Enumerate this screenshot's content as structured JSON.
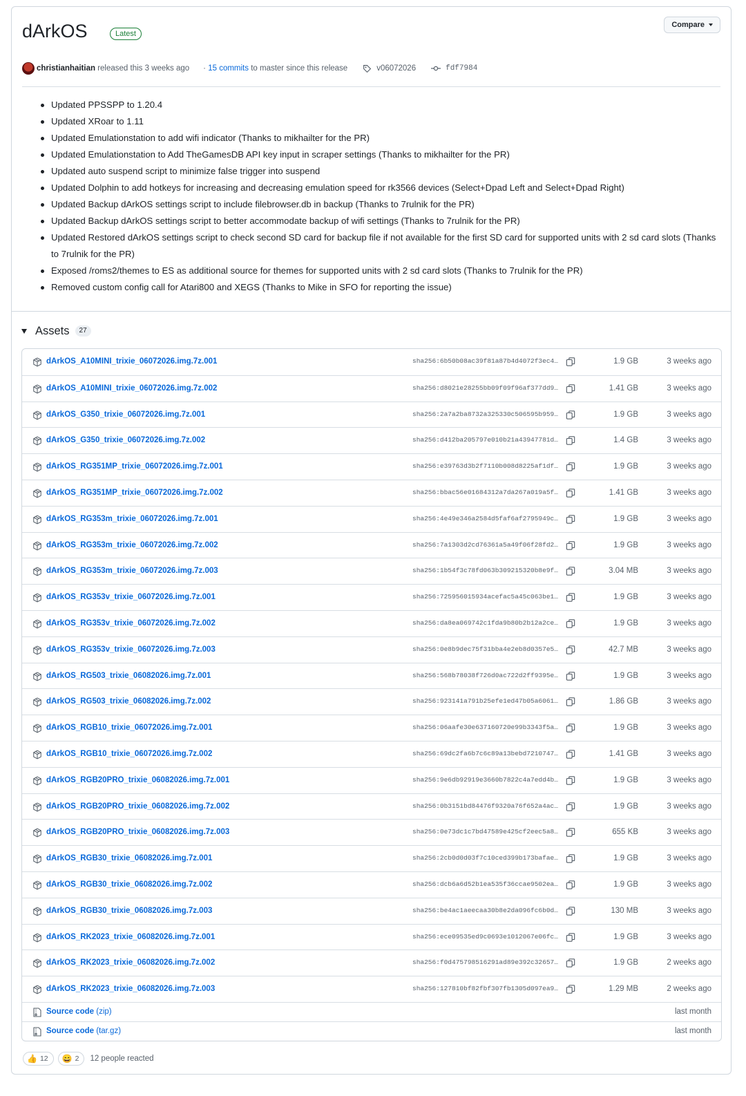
{
  "release": {
    "title": "dArkOS",
    "badge": "Latest",
    "compare_label": "Compare",
    "author": "christianhaitian",
    "released_text": "released this 3 weeks ago",
    "commits_link": "15 commits",
    "commits_text": "to master since this release",
    "tag": "v06072026",
    "commit": "fdf7984"
  },
  "notes": [
    "Updated PPSSPP to 1.20.4",
    "Updated XRoar to 1.11",
    "Updated Emulationstation to add wifi indicator (Thanks to mikhailter for the PR)",
    "Updated Emulationstation to Add TheGamesDB API key input in scraper settings (Thanks to mikhailter for the PR)",
    "Updated auto suspend script to minimize false trigger into suspend",
    "Updated Dolphin to add hotkeys for increasing and decreasing emulation speed for rk3566 devices (Select+Dpad Left and Select+Dpad Right)",
    "Updated Backup dArkOS settings script to include filebrowser.db in backup (Thanks to 7rulnik for the PR)",
    "Updated Backup dArkOS settings script to better accommodate backup of wifi settings (Thanks to 7rulnik for the PR)",
    "Updated Restored dArkOS settings script to check second SD card for backup file if not available for the first SD card for supported units with 2 sd card slots (Thanks to 7rulnik for the PR)",
    "Exposed /roms2/themes to ES as additional source for themes for supported units with 2 sd card slots (Thanks to 7rulnik for the PR)",
    "Removed custom config call for Atari800 and XEGS (Thanks to Mike in SFO for reporting the issue)"
  ],
  "assets": {
    "label": "Assets",
    "count": "27",
    "files": [
      {
        "name": "dArkOS_A10MINI_trixie_06072026.img.7z.001",
        "sha": "sha256:6b50b08ac39f81a87b4d4072f3ec4...",
        "size": "1.9 GB",
        "date": "3 weeks ago"
      },
      {
        "name": "dArkOS_A10MINI_trixie_06072026.img.7z.002",
        "sha": "sha256:d8021e28255bb09f09f96af377dd9...",
        "size": "1.41 GB",
        "date": "3 weeks ago"
      },
      {
        "name": "dArkOS_G350_trixie_06072026.img.7z.001",
        "sha": "sha256:2a7a2ba8732a325330c506595b959...",
        "size": "1.9 GB",
        "date": "3 weeks ago"
      },
      {
        "name": "dArkOS_G350_trixie_06072026.img.7z.002",
        "sha": "sha256:d412ba205797e010b21a43947781d...",
        "size": "1.4 GB",
        "date": "3 weeks ago"
      },
      {
        "name": "dArkOS_RG351MP_trixie_06072026.img.7z.001",
        "sha": "sha256:e39763d3b2f7110b008d8225af1df...",
        "size": "1.9 GB",
        "date": "3 weeks ago"
      },
      {
        "name": "dArkOS_RG351MP_trixie_06072026.img.7z.002",
        "sha": "sha256:bbac56e01684312a7da267a019a5f...",
        "size": "1.41 GB",
        "date": "3 weeks ago"
      },
      {
        "name": "dArkOS_RG353m_trixie_06072026.img.7z.001",
        "sha": "sha256:4e49e346a2584d5faf6af2795949c...",
        "size": "1.9 GB",
        "date": "3 weeks ago"
      },
      {
        "name": "dArkOS_RG353m_trixie_06072026.img.7z.002",
        "sha": "sha256:7a1303d2cd76361a5a49f06f28fd2...",
        "size": "1.9 GB",
        "date": "3 weeks ago"
      },
      {
        "name": "dArkOS_RG353m_trixie_06072026.img.7z.003",
        "sha": "sha256:1b54f3c78fd063b309215320b8e9f...",
        "size": "3.04 MB",
        "date": "3 weeks ago"
      },
      {
        "name": "dArkOS_RG353v_trixie_06072026.img.7z.001",
        "sha": "sha256:725956015934acefac5a45c063be1...",
        "size": "1.9 GB",
        "date": "3 weeks ago"
      },
      {
        "name": "dArkOS_RG353v_trixie_06072026.img.7z.002",
        "sha": "sha256:da8ea069742c1fda9b80b2b12a2ce...",
        "size": "1.9 GB",
        "date": "3 weeks ago"
      },
      {
        "name": "dArkOS_RG353v_trixie_06072026.img.7z.003",
        "sha": "sha256:0e8b9dec75f31bba4e2eb8d0357e5...",
        "size": "42.7 MB",
        "date": "3 weeks ago"
      },
      {
        "name": "dArkOS_RG503_trixie_06082026.img.7z.001",
        "sha": "sha256:568b78038f726d0ac722d2ff9395e...",
        "size": "1.9 GB",
        "date": "3 weeks ago"
      },
      {
        "name": "dArkOS_RG503_trixie_06082026.img.7z.002",
        "sha": "sha256:923141a791b25efe1ed47b05a6061...",
        "size": "1.86 GB",
        "date": "3 weeks ago"
      },
      {
        "name": "dArkOS_RGB10_trixie_06072026.img.7z.001",
        "sha": "sha256:06aafe30e637160720e99b3343f5a...",
        "size": "1.9 GB",
        "date": "3 weeks ago"
      },
      {
        "name": "dArkOS_RGB10_trixie_06072026.img.7z.002",
        "sha": "sha256:69dc2fa6b7c6c89a13bebd7210747...",
        "size": "1.41 GB",
        "date": "3 weeks ago"
      },
      {
        "name": "dArkOS_RGB20PRO_trixie_06082026.img.7z.001",
        "sha": "sha256:9e6db92919e3660b7822c4a7edd4b...",
        "size": "1.9 GB",
        "date": "3 weeks ago"
      },
      {
        "name": "dArkOS_RGB20PRO_trixie_06082026.img.7z.002",
        "sha": "sha256:0b3151bd84476f9320a76f652a4ac...",
        "size": "1.9 GB",
        "date": "3 weeks ago"
      },
      {
        "name": "dArkOS_RGB20PRO_trixie_06082026.img.7z.003",
        "sha": "sha256:0e73dc1c7bd47589e425cf2eec5a8...",
        "size": "655 KB",
        "date": "3 weeks ago"
      },
      {
        "name": "dArkOS_RGB30_trixie_06082026.img.7z.001",
        "sha": "sha256:2cb0d0d03f7c10ced399b173bafae...",
        "size": "1.9 GB",
        "date": "3 weeks ago"
      },
      {
        "name": "dArkOS_RGB30_trixie_06082026.img.7z.002",
        "sha": "sha256:dcb6a6d52b1ea535f36ccae9502ea...",
        "size": "1.9 GB",
        "date": "3 weeks ago"
      },
      {
        "name": "dArkOS_RGB30_trixie_06082026.img.7z.003",
        "sha": "sha256:be4ac1aeecaa30b8e2da096fc6b0d...",
        "size": "130 MB",
        "date": "3 weeks ago"
      },
      {
        "name": "dArkOS_RK2023_trixie_06082026.img.7z.001",
        "sha": "sha256:ece09535ed9c0693e1012067e06fc...",
        "size": "1.9 GB",
        "date": "3 weeks ago"
      },
      {
        "name": "dArkOS_RK2023_trixie_06082026.img.7z.002",
        "sha": "sha256:f0d475798516291ad89e392c32657...",
        "size": "1.9 GB",
        "date": "2 weeks ago"
      },
      {
        "name": "dArkOS_RK2023_trixie_06082026.img.7z.003",
        "sha": "sha256:127810bf82fbf307fb1305d097ea9...",
        "size": "1.29 MB",
        "date": "2 weeks ago"
      }
    ],
    "source": [
      {
        "label": "Source code",
        "ext": "(zip)",
        "date": "last month"
      },
      {
        "label": "Source code",
        "ext": "(tar.gz)",
        "date": "last month"
      }
    ]
  },
  "reactions": {
    "thumbs_up": "12",
    "laugh": "2",
    "summary": "12 people reacted"
  },
  "icons": {
    "package": "package-icon",
    "copy": "copy-icon",
    "zip": "file-zip-icon",
    "tag": "tag-icon",
    "commit": "git-commit-icon"
  },
  "colors": {
    "link": "#0969da",
    "latest": "#1a7f37",
    "muted": "#57606a",
    "border": "#d0d7de"
  }
}
